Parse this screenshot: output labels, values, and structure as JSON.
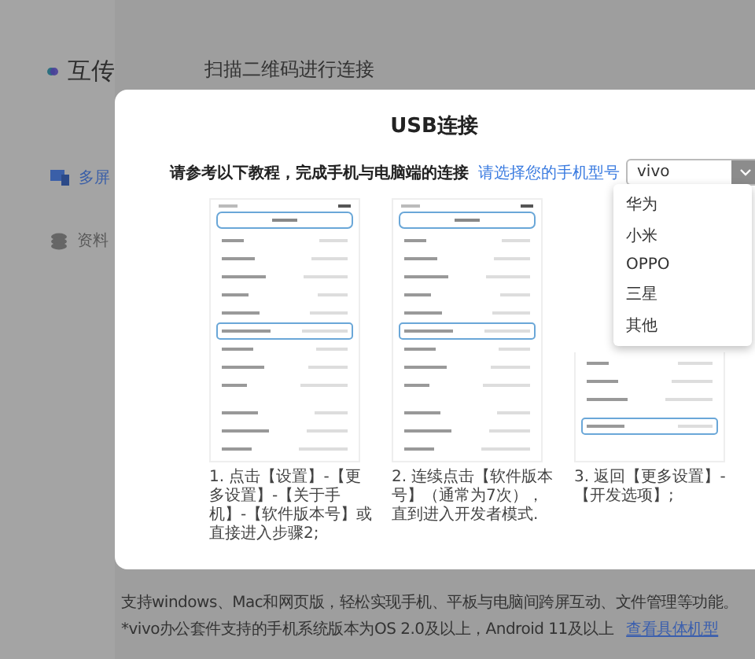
{
  "app": {
    "name": "互传",
    "header": "扫描二维码进行连接"
  },
  "sidebar": {
    "items": [
      {
        "label": "多屏",
        "kind": "screens",
        "selected": true
      },
      {
        "label": "资料",
        "kind": "stack",
        "selected": false
      }
    ]
  },
  "footer": {
    "lines": [
      "支持windows、Mac和网页版，轻松实现手机、平板与电脑间跨屏互动、文件管理等功能。",
      "*vivo办公套件支持的手机系统版本为OS 2.0及以上，Android 11及以上"
    ],
    "link": "查看具体机型"
  },
  "dialog": {
    "title": "USB连接",
    "instruction": "请参考以下教程，完成手机与电脑端的连接",
    "model_prompt": "请选择您的手机型号",
    "select": {
      "value": "vivo",
      "expanded": true,
      "options": [
        "华为",
        "小米",
        "OPPO",
        "三星",
        "其他"
      ]
    },
    "steps": [
      {
        "caption": "1. 点击【设置】-【更多设置】-【关于手机】-【软件版本号】或直接进入步骤2;",
        "kind": "about"
      },
      {
        "caption": "2. 连续点击【软件版本号】（通常为7次），直到进入开发者模式.",
        "kind": "about"
      },
      {
        "caption": "3. 返回【更多设置】-【开发选项】;",
        "kind": "settings"
      }
    ]
  }
}
